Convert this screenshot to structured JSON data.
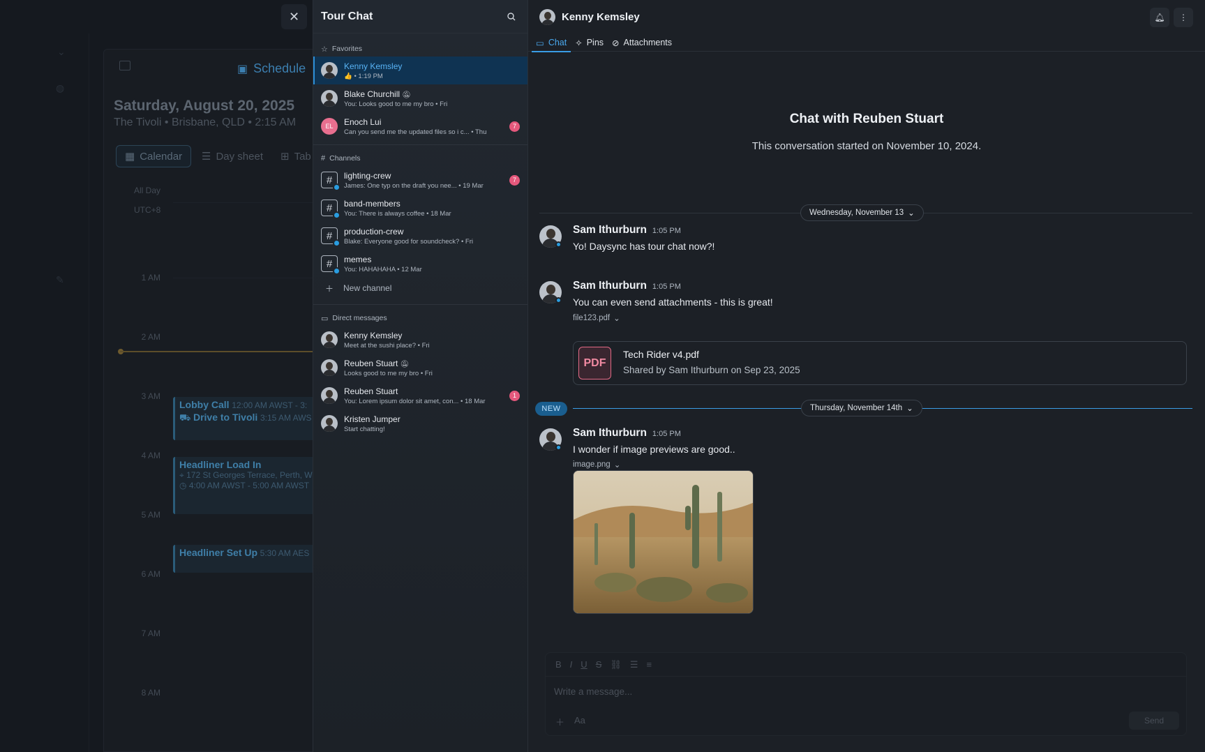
{
  "background_app": {
    "schedule_tab": "Schedule",
    "date": "Saturday, August 20, 2025",
    "location": "The Tivoli • Brisbane, QLD • 2:15 AM",
    "views": [
      "Calendar",
      "Day sheet",
      "Tab"
    ],
    "all_day": "All Day",
    "timezone": "UTC+8",
    "hours": [
      "1 AM",
      "2 AM",
      "3 AM",
      "4 AM",
      "5 AM",
      "6 AM",
      "7 AM",
      "8 AM"
    ],
    "events": [
      {
        "title": "Lobby Call",
        "time": "12:00 AM AWST - 3:"
      },
      {
        "title": "Drive to Tivoli",
        "time": "3:15 AM AWS"
      },
      {
        "title": "Headliner Load In",
        "address": "172 St Georges Terrace, Perth, W",
        "time": "4:00 AM AWST - 5:00 AM AWST"
      },
      {
        "title": "Headliner Set Up",
        "time": "5:30 AM AES"
      }
    ]
  },
  "chat_list": {
    "title": "Tour Chat",
    "favorites_label": "Favorites",
    "favorites": [
      {
        "name": "Kenny Kemsley",
        "sub": "👍 • 1:19 PM",
        "active": true
      },
      {
        "name": "Blake Churchill",
        "sub": "You: Looks good to me my bro • Fri",
        "muted": true
      },
      {
        "name": "Enoch Lui",
        "initials": "EL",
        "sub": "Can you send me the updated files so i c... • Thu",
        "badge": "7"
      }
    ],
    "channels_label": "Channels",
    "channels": [
      {
        "name": "lighting-crew",
        "sub": "James: One typ on the draft you nee... • 19 Mar",
        "badge": "7"
      },
      {
        "name": "band-members",
        "sub": "You: There is always coffee • 18 Mar"
      },
      {
        "name": "production-crew",
        "sub": "Blake: Everyone good for soundcheck? • Fri"
      },
      {
        "name": "memes",
        "sub": "You: HAHAHAHA • 12 Mar"
      }
    ],
    "new_channel_label": "New channel",
    "dm_label": "Direct messages",
    "direct_messages": [
      {
        "name": "Kenny Kemsley",
        "sub": "Meet at the sushi place? • Fri"
      },
      {
        "name": "Reuben Stuart",
        "sub": "Looks good to me my bro • Fri",
        "muted": true
      },
      {
        "name": "Reuben Stuart",
        "sub": "You: Lorem ipsum dolor sit amet, con... • 18 Mar",
        "badge": "1"
      },
      {
        "name": "Kristen Jumper",
        "sub": "Start chatting!"
      }
    ]
  },
  "chat": {
    "header_name": "Kenny Kemsley",
    "tabs": [
      "Chat",
      "Pins",
      "Attachments"
    ],
    "intro_title": "Chat with Reuben Stuart",
    "intro_sub": "This conversation started on November 10, 2024.",
    "date_1": "Wednesday, November 13",
    "date_2": "Thursday, November 14th",
    "new_label": "NEW",
    "messages": [
      {
        "author": "Sam Ithurburn",
        "time": "1:05 PM",
        "text": "Yo! Daysync has tour chat now?!"
      },
      {
        "author": "Sam Ithurburn",
        "time": "1:05 PM",
        "text": "You can even send attachments - this is great!",
        "file": "file123.pdf",
        "attachment_title": "Tech Rider v4.pdf",
        "attachment_sub": "Shared by Sam Ithurburn on Sep 23, 2025",
        "attachment_type": "PDF"
      },
      {
        "author": "Sam Ithurburn",
        "time": "1:05 PM",
        "text": "I wonder if image previews are good..",
        "file": "image.png"
      }
    ],
    "composer_placeholder": "Write a message...",
    "composer_aa": "Aa",
    "send_label": "Send"
  },
  "colors": {
    "accent": "#3a9de6",
    "badge": "#e5587c",
    "active_item": "#0f3352"
  }
}
